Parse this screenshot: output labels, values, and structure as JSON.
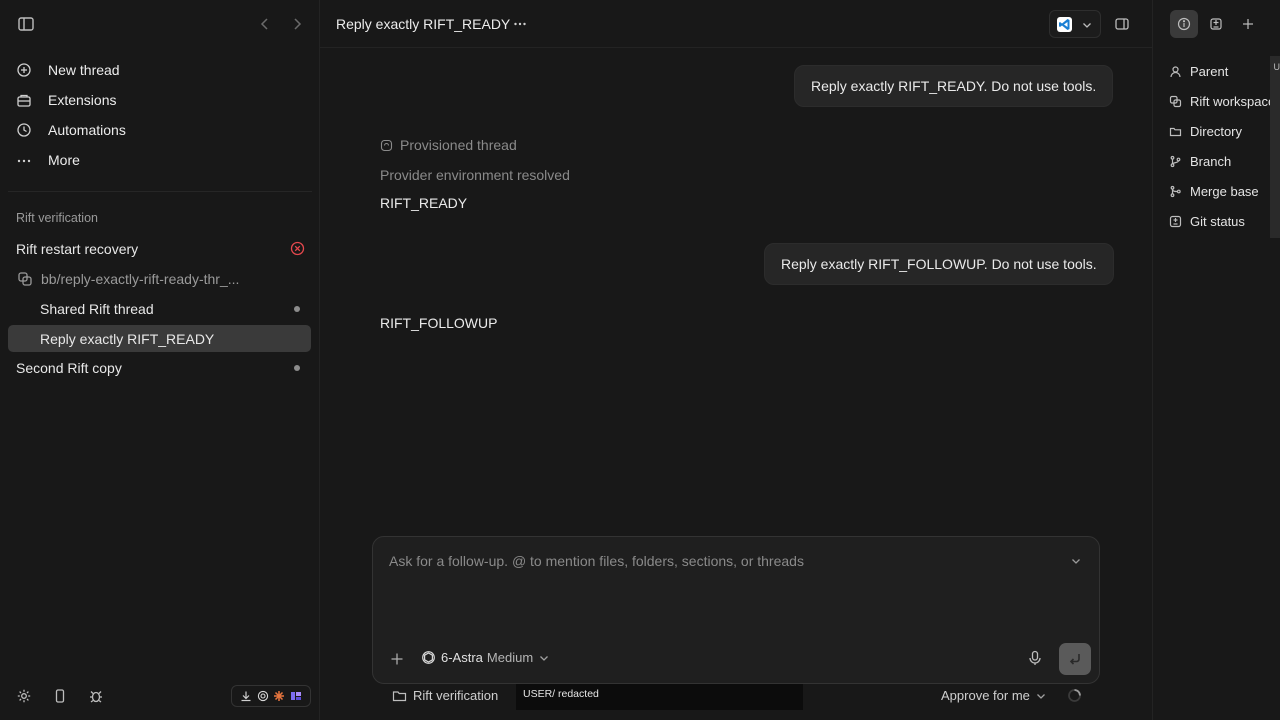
{
  "sidebar": {
    "nav": [
      {
        "label": "New thread",
        "icon": "new-thread-icon"
      },
      {
        "label": "Extensions",
        "icon": "extensions-icon"
      },
      {
        "label": "Automations",
        "icon": "automations-icon"
      },
      {
        "label": "More",
        "icon": "more-icon"
      }
    ],
    "section_title": "Rift verification",
    "threads": {
      "restart_recovery": "Rift restart recovery",
      "worktree": "bb/reply-exactly-rift-ready-thr_...",
      "shared": "Shared Rift thread",
      "reply_ready": "Reply exactly RIFT_READY",
      "second_copy": "Second Rift copy"
    }
  },
  "header": {
    "title": "Reply exactly RIFT_READY"
  },
  "chat": {
    "user_msg_1": "Reply exactly RIFT_READY. Do not use tools.",
    "status_1": "Provisioned thread",
    "status_2": "Provider environment resolved",
    "reply_1": "RIFT_READY",
    "user_msg_2": "Reply exactly RIFT_FOLLOWUP. Do not use tools.",
    "reply_2": "RIFT_FOLLOWUP"
  },
  "composer": {
    "placeholder": "Ask for a follow-up. @ to mention files, folders, sections, or threads",
    "model_name": "6-Astra",
    "model_tier": "Medium"
  },
  "footer": {
    "workspace": "Rift verification",
    "redacted_text": "USER/ redacted",
    "approval": "Approve for me"
  },
  "right_panel": {
    "items": [
      {
        "label": "Parent",
        "icon": "person-icon"
      },
      {
        "label": "Rift workspace",
        "icon": "worktree-icon"
      },
      {
        "label": "Directory",
        "icon": "folder-icon"
      },
      {
        "label": "Branch",
        "icon": "branch-icon"
      },
      {
        "label": "Merge base",
        "icon": "merge-icon"
      },
      {
        "label": "Git status",
        "icon": "git-status-icon"
      }
    ],
    "scroll_label": "U"
  },
  "colors": {
    "background": "#181818",
    "selected_row": "#3a3a3a",
    "error": "#e5484d",
    "bubble": "#262626"
  }
}
